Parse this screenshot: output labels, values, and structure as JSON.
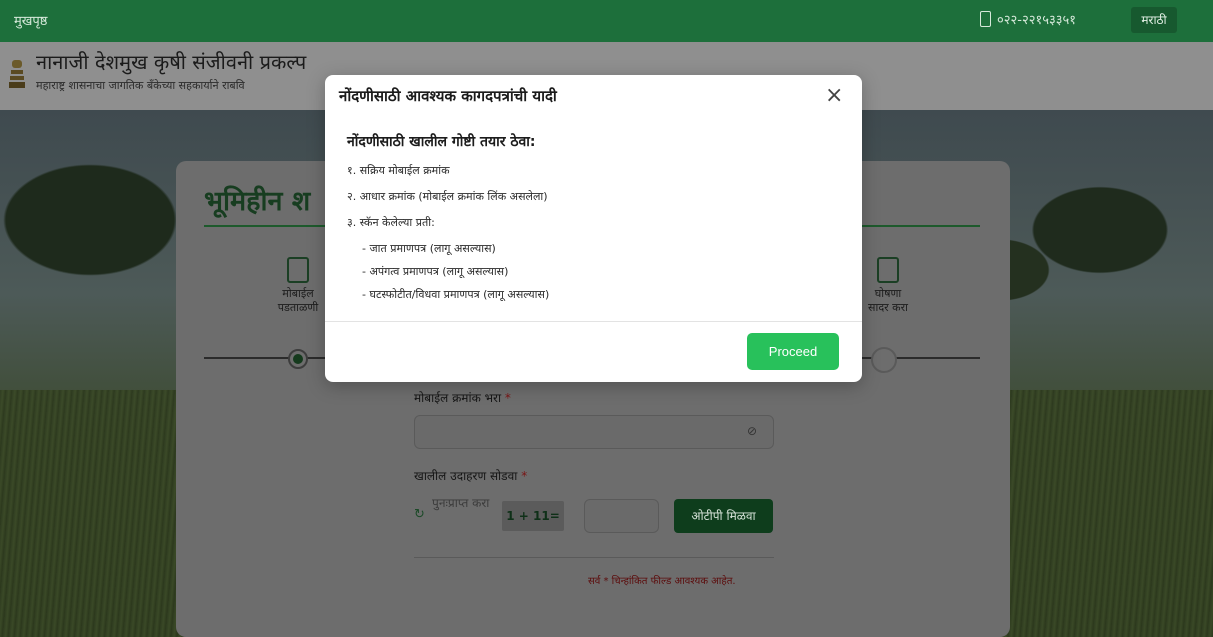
{
  "topbar": {
    "home_label": "मुखपृष्ठ",
    "phone": "०२२-२२१५३३५१",
    "lang_label": "मराठी"
  },
  "header": {
    "brand": "नानाजी देशमुख कृषी संजीवनी प्रकल्प",
    "subbrand": "महाराष्ट्र शासनाचा जागतिक बँकेच्या सहकार्याने राबवि"
  },
  "card": {
    "title": "भूमिहीन श",
    "steps": [
      {
        "label_line1": "मोबाईल",
        "label_line2": "पडताळणी"
      },
      {
        "label_line1": "घोषणा",
        "label_line2": "सादर करा"
      }
    ],
    "mobile_label": "मोबाईल क्रमांक भरा",
    "required_mark": "*",
    "captcha_label": "खालील उदाहरण सोडवा",
    "resend_label": "पुनःप्राप्त करा",
    "captcha_text": "1 + 11=",
    "otp_button": "ओटीपी मिळवा",
    "footnote": "सर्व * चिन्हांकित फील्ड आवश्यक आहेत."
  },
  "modal": {
    "header": "नोंदणीसाठी आवश्यक कागदपत्रांची यादी",
    "close_symbol": "×",
    "title": "नोंदणीसाठी खालील गोष्टी तयार ठेवा:",
    "lines": [
      "१. सक्रिय मोबाईल क्रमांक",
      "२. आधार क्रमांक (मोबाईल क्रमांक लिंक असलेला)",
      "३. स्कॅन केलेल्या प्रती:",
      "- जात प्रमाणपत्र (लागू असल्यास)",
      "- अपंगत्व प्रमाणपत्र (लागू असल्यास)",
      "- घटस्फोटीत/विधवा प्रमाणपत्र (लागू असल्यास)"
    ],
    "proceed_label": "Proceed"
  },
  "colors": {
    "topbar": "#1d6f3b",
    "proceed": "#28c15b",
    "otp_button": "#0e3d1c"
  }
}
